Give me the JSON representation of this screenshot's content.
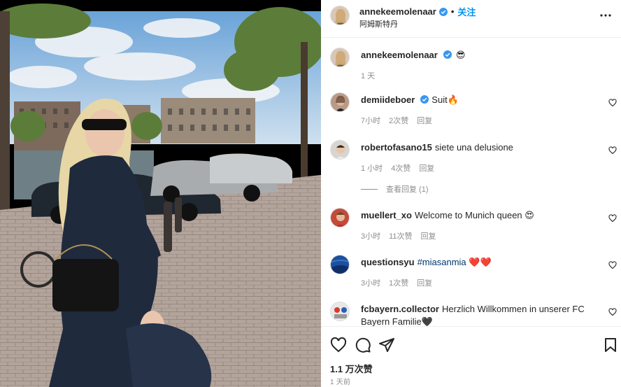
{
  "post": {
    "username": "annekeemolenaar",
    "follow_label": "关注",
    "separator": "•",
    "location": "阿姆斯特丹",
    "more_icon": "more-horizontal-icon"
  },
  "caption": {
    "username": "annekeemolenaar",
    "text": "😎",
    "time": "1 天"
  },
  "comments": [
    {
      "username": "demiideboer",
      "verified": true,
      "text": "Suit🔥",
      "time": "7小时",
      "likes": "2次赞",
      "reply_label": "回复"
    },
    {
      "username": "robertofasano15",
      "verified": false,
      "text": "siete una delusione",
      "time": "1 小时",
      "likes": "4次赞",
      "reply_label": "回复",
      "view_replies": "查看回复 (1)"
    },
    {
      "username": "muellert_xo",
      "verified": false,
      "text": "Welcome to Munich queen 😍",
      "time": "3小时",
      "likes": "11次赞",
      "reply_label": "回复"
    },
    {
      "username": "questionsyu",
      "verified": false,
      "text_hashtag": "#miasanmia",
      "text": "❤️❤️",
      "time": "3小时",
      "likes": "1次赞",
      "reply_label": "回复"
    },
    {
      "username": "fcbayern.collector",
      "verified": false,
      "text": "Herzlich Willkommen in unserer FC Bayern Familie🖤"
    }
  ],
  "actions": {
    "like_icon": "heart-icon",
    "comment_icon": "comment-icon",
    "share_icon": "send-icon",
    "save_icon": "bookmark-icon",
    "likes_count": "1.1 万次赞",
    "posted": "1 天前"
  },
  "colors": {
    "accent": "#0095f6",
    "verified": "#3897f0",
    "muted": "#8e8e8e",
    "text": "#262626",
    "hashtag": "#00376b"
  }
}
